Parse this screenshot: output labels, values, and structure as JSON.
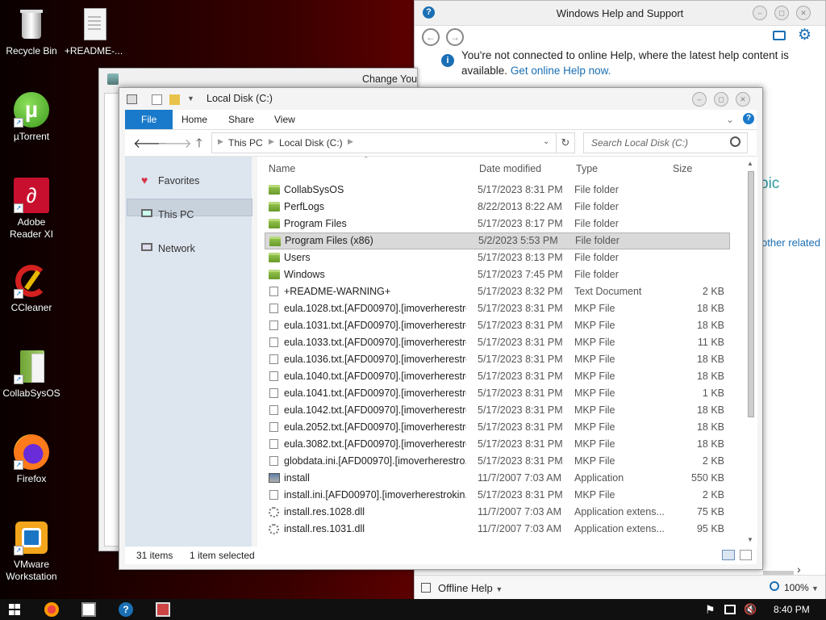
{
  "desktop": {
    "icons": [
      {
        "label": "Recycle Bin"
      },
      {
        "label": "+README-..."
      },
      {
        "label": "µTorrent"
      },
      {
        "label": "Adobe Reader XI"
      },
      {
        "label": "CCleaner"
      },
      {
        "label": "CollabSysOS"
      },
      {
        "label": "Firefox"
      },
      {
        "label": "VMware Workstation"
      }
    ]
  },
  "help": {
    "title": "Windows Help and Support",
    "message": "You're not connected to online Help, where the latest help content is available.",
    "link": "Get online Help now.",
    "partial1": "pic",
    "partial2": "other related",
    "offline": "Offline Help",
    "zoom": "100%"
  },
  "change_window": {
    "title": "Change You"
  },
  "explorer": {
    "title": "Local Disk (C:)",
    "tabs": [
      "File",
      "Home",
      "Share",
      "View"
    ],
    "breadcrumb": [
      "This PC",
      "Local Disk (C:)"
    ],
    "search_placeholder": "Search Local Disk (C:)",
    "nav": [
      "Favorites",
      "This PC",
      "Network"
    ],
    "columns": {
      "name": "Name",
      "date": "Date modified",
      "type": "Type",
      "size": "Size"
    },
    "files": [
      {
        "name": "CollabSysOS",
        "date": "5/17/2023 8:31 PM",
        "type": "File folder",
        "size": "",
        "kind": "folder"
      },
      {
        "name": "PerfLogs",
        "date": "8/22/2013 8:22 AM",
        "type": "File folder",
        "size": "",
        "kind": "folder"
      },
      {
        "name": "Program Files",
        "date": "5/17/2023 8:17 PM",
        "type": "File folder",
        "size": "",
        "kind": "folder"
      },
      {
        "name": "Program Files (x86)",
        "date": "5/2/2023 5:53 PM",
        "type": "File folder",
        "size": "",
        "kind": "folder"
      },
      {
        "name": "Users",
        "date": "5/17/2023 8:13 PM",
        "type": "File folder",
        "size": "",
        "kind": "folder"
      },
      {
        "name": "Windows",
        "date": "5/17/2023 7:45 PM",
        "type": "File folder",
        "size": "",
        "kind": "folder"
      },
      {
        "name": "+README-WARNING+",
        "date": "5/17/2023 8:32 PM",
        "type": "Text Document",
        "size": "2 KB",
        "kind": "doc"
      },
      {
        "name": "eula.1028.txt.[AFD00970].[imoverherestro...",
        "date": "5/17/2023 8:31 PM",
        "type": "MKP File",
        "size": "18 KB",
        "kind": "doc"
      },
      {
        "name": "eula.1031.txt.[AFD00970].[imoverherestro...",
        "date": "5/17/2023 8:31 PM",
        "type": "MKP File",
        "size": "18 KB",
        "kind": "doc"
      },
      {
        "name": "eula.1033.txt.[AFD00970].[imoverherestro...",
        "date": "5/17/2023 8:31 PM",
        "type": "MKP File",
        "size": "11 KB",
        "kind": "doc"
      },
      {
        "name": "eula.1036.txt.[AFD00970].[imoverherestro...",
        "date": "5/17/2023 8:31 PM",
        "type": "MKP File",
        "size": "18 KB",
        "kind": "doc"
      },
      {
        "name": "eula.1040.txt.[AFD00970].[imoverherestro...",
        "date": "5/17/2023 8:31 PM",
        "type": "MKP File",
        "size": "18 KB",
        "kind": "doc"
      },
      {
        "name": "eula.1041.txt.[AFD00970].[imoverherestro...",
        "date": "5/17/2023 8:31 PM",
        "type": "MKP File",
        "size": "1 KB",
        "kind": "doc"
      },
      {
        "name": "eula.1042.txt.[AFD00970].[imoverherestro...",
        "date": "5/17/2023 8:31 PM",
        "type": "MKP File",
        "size": "18 KB",
        "kind": "doc"
      },
      {
        "name": "eula.2052.txt.[AFD00970].[imoverherestro...",
        "date": "5/17/2023 8:31 PM",
        "type": "MKP File",
        "size": "18 KB",
        "kind": "doc"
      },
      {
        "name": "eula.3082.txt.[AFD00970].[imoverherestro...",
        "date": "5/17/2023 8:31 PM",
        "type": "MKP File",
        "size": "18 KB",
        "kind": "doc"
      },
      {
        "name": "globdata.ini.[AFD00970].[imoverherestro...",
        "date": "5/17/2023 8:31 PM",
        "type": "MKP File",
        "size": "2 KB",
        "kind": "doc"
      },
      {
        "name": "install",
        "date": "11/7/2007 7:03 AM",
        "type": "Application",
        "size": "550 KB",
        "kind": "app"
      },
      {
        "name": "install.ini.[AFD00970].[imoverherestrokin...",
        "date": "5/17/2023 8:31 PM",
        "type": "MKP File",
        "size": "2 KB",
        "kind": "doc"
      },
      {
        "name": "install.res.1028.dll",
        "date": "11/7/2007 7:03 AM",
        "type": "Application extens...",
        "size": "75 KB",
        "kind": "gear"
      },
      {
        "name": "install.res.1031.dll",
        "date": "11/7/2007 7:03 AM",
        "type": "Application extens...",
        "size": "95 KB",
        "kind": "gear"
      }
    ],
    "selected_index": 3,
    "status_count": "31 items",
    "status_selected": "1 item selected"
  },
  "taskbar": {
    "time": "8:40 PM"
  }
}
